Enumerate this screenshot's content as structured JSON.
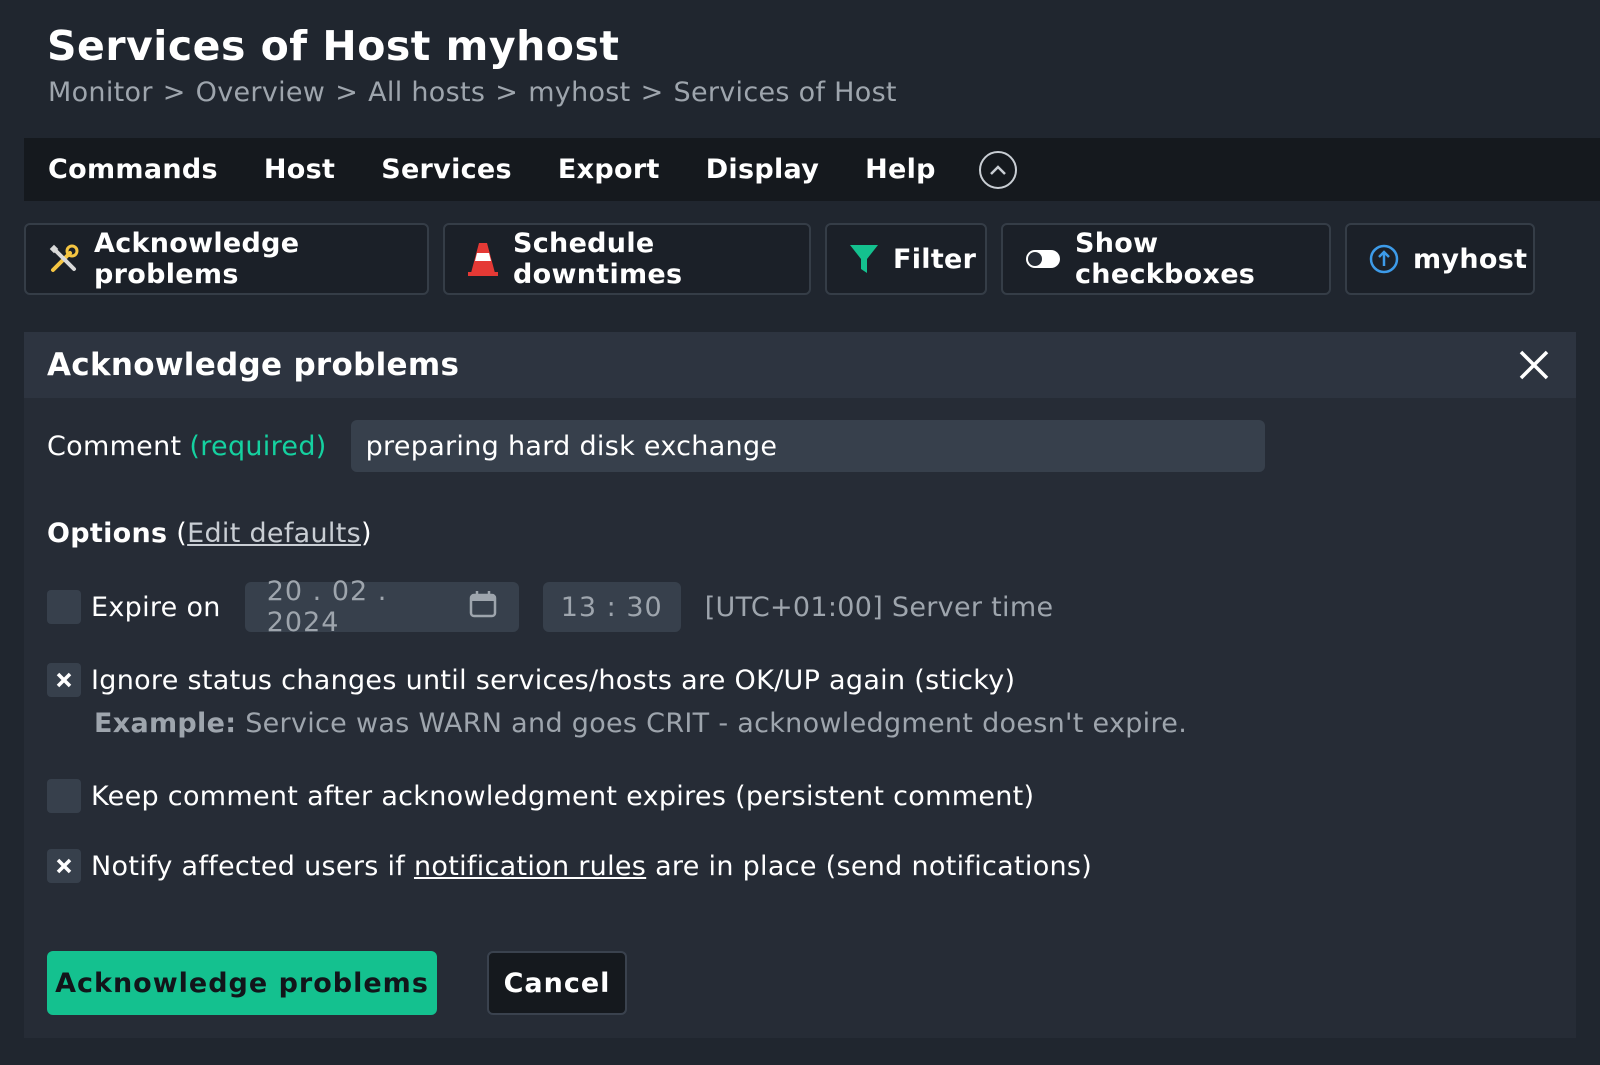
{
  "header": {
    "title": "Services of Host myhost",
    "breadcrumb": [
      "Monitor",
      "Overview",
      "All hosts",
      "myhost",
      "Services of Host"
    ],
    "separator": ">"
  },
  "menu": {
    "items": [
      "Commands",
      "Host",
      "Services",
      "Export",
      "Display",
      "Help"
    ]
  },
  "toolbar": {
    "acknowledge": "Acknowledge problems",
    "downtimes": "Schedule downtimes",
    "filter": "Filter",
    "checkboxes": "Show checkboxes",
    "host": "myhost"
  },
  "panel": {
    "title": "Acknowledge problems",
    "comment_label": "Comment",
    "comment_required": "(required)",
    "comment_value": "preparing hard disk exchange",
    "options_label": "Options",
    "options_open": "(",
    "edit_defaults": "Edit defaults",
    "options_close": ")",
    "expire": {
      "label": "Expire on",
      "checked": false,
      "date_day": "20",
      "date_month": "02",
      "date_year": "2024",
      "time_hour": "13",
      "time_minute": "30",
      "timezone": "[UTC+01:00] Server time"
    },
    "sticky": {
      "label": "Ignore status changes until services/hosts are OK/UP again (sticky)",
      "checked": true,
      "example_bold": "Example:",
      "example_text": "Service was WARN and goes CRIT - acknowledgment doesn't expire."
    },
    "persistent": {
      "label": "Keep comment after acknowledgment expires (persistent comment)",
      "checked": false
    },
    "notify": {
      "label_before": "Notify affected users if",
      "link": "notification rules",
      "label_after": "are in place (send notifications)",
      "checked": true
    },
    "submit_label": "Acknowledge problems",
    "cancel_label": "Cancel"
  },
  "colors": {
    "accent": "#14c18f",
    "required": "#15d1a0",
    "background": "#20262f",
    "panel": "#262c36"
  },
  "icons": {
    "acknowledge": "wrench-screwdriver-icon",
    "downtimes": "traffic-cone-icon",
    "filter": "funnel-icon",
    "checkboxes": "toggle-off-icon",
    "host": "arrow-up-circle-icon",
    "collapse": "chevron-up-circle-icon",
    "close": "close-icon",
    "calendar": "calendar-icon",
    "checkmark": "checkbox-x-icon"
  }
}
